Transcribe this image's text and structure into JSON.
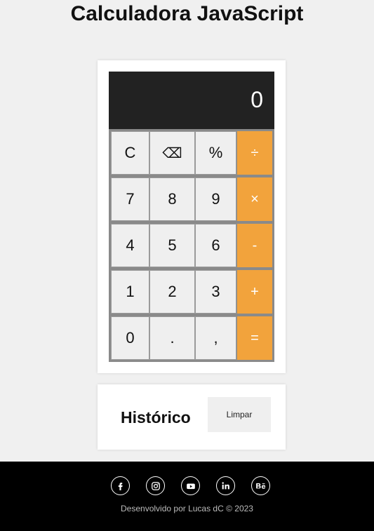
{
  "page": {
    "title": "Calculadora JavaScript"
  },
  "display": {
    "value": "0"
  },
  "keys": [
    [
      "C",
      "⌫",
      "%",
      "÷"
    ],
    [
      "7",
      "8",
      "9",
      "×"
    ],
    [
      "4",
      "5",
      "6",
      "-"
    ],
    [
      "1",
      "2",
      "3",
      "+"
    ],
    [
      "0",
      ".",
      ",",
      "="
    ]
  ],
  "history": {
    "title": "Histórico",
    "clear_label": "Limpar"
  },
  "footer": {
    "text": "Desenvolvido por Lucas dC © 2023",
    "icons": [
      "facebook-icon",
      "instagram-icon",
      "youtube-icon",
      "linkedin-icon",
      "behance-icon"
    ]
  },
  "colors": {
    "operator": "#f2a33c",
    "display_bg": "#222222",
    "key_bg": "#efefef",
    "footer_bg": "#000000"
  }
}
